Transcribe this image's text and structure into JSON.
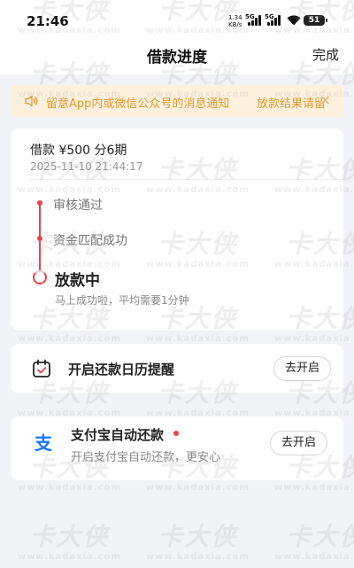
{
  "status_bar": {
    "time": "21:46",
    "net_speed": "1.34",
    "net_unit": "KB/s",
    "sim1_label": "5G",
    "sim2_label": "5G",
    "battery": "51",
    "icons": [
      "signal-icon",
      "wifi-icon",
      "battery-icon"
    ]
  },
  "nav": {
    "title": "借款进度",
    "done_label": "完成"
  },
  "notice": {
    "icon": "speaker-icon",
    "text": "留意App内或微信公众号的消息通知",
    "text_right": "放款结果请留",
    "close_icon": "close-icon",
    "color": "#e0992e",
    "background": "#fdf1de"
  },
  "loan": {
    "summary": "借款 ¥500 分6期",
    "time": "2025-11-10 21:44:17",
    "steps": [
      {
        "label": "审核通过"
      },
      {
        "label": "资金匹配成功"
      }
    ],
    "current_step": "放款中",
    "current_hint": "马上成功啦，平均需要1分钟",
    "accent_color": "#e8424a"
  },
  "calendar": {
    "icon": "calendar-check-icon",
    "label": "开启还款日历提醒",
    "button": "去开启"
  },
  "alipay": {
    "icon": "alipay-icon",
    "title": "支付宝自动还款",
    "desc": "开启支付宝自动还款，更安心",
    "button": "去开启",
    "brand_color": "#1677ff"
  },
  "watermark": {
    "title": "卡大侠",
    "url": "www.kadaxia.com"
  }
}
